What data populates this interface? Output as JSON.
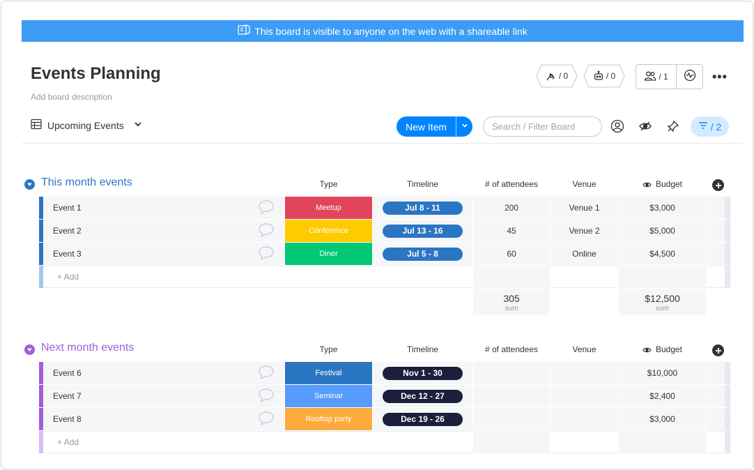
{
  "banner": {
    "text": "This board is visible to anyone on the web with a shareable link"
  },
  "board": {
    "title": "Events Planning",
    "description": "Add board description"
  },
  "header": {
    "integrations_count": "/ 0",
    "automations_count": "/ 0",
    "members_count": "/ 1"
  },
  "toolbar": {
    "view_name": "Upcoming Events",
    "new_item_label": "New Item",
    "search_placeholder": "Search / Filter Board",
    "filter_count": "/ 2"
  },
  "columns": {
    "type": "Type",
    "timeline": "Timeline",
    "attendees": "# of attendees",
    "venue": "Venue",
    "budget": "Budget"
  },
  "groups": [
    {
      "title": "This month events",
      "color": "#2b76c3",
      "strip_color": "#2b76c3",
      "add_strip_color": "#a5c8ea",
      "add_label": "+ Add",
      "rows": [
        {
          "name": "Event 1",
          "type": "Meetup",
          "type_color": "#e2445c",
          "timeline": "Jul 8 - 11",
          "timeline_color": "#2b76c3",
          "attendees": "200",
          "venue": "Venue 1",
          "budget": "$3,000"
        },
        {
          "name": "Event 2",
          "type": "Conference",
          "type_color": "#ffcb00",
          "timeline": "Jul 13 - 16",
          "timeline_color": "#2b76c3",
          "attendees": "45",
          "venue": "Venue 2",
          "budget": "$5,000"
        },
        {
          "name": "Event 3",
          "type": "Diner",
          "type_color": "#00c875",
          "timeline": "Jul 5 - 8",
          "timeline_color": "#2b76c3",
          "attendees": "60",
          "venue": "Online",
          "budget": "$4,500"
        }
      ],
      "summary": {
        "attendees": "305",
        "budget": "$12,500",
        "label": "sum"
      }
    },
    {
      "title": "Next month events",
      "color": "#a25ddc",
      "strip_color": "#a25ddc",
      "add_strip_color": "#d8bff0",
      "add_label": "+ Add",
      "rows": [
        {
          "name": "Event 6",
          "type": "Festival",
          "type_color": "#2b76c3",
          "timeline": "Nov 1 - 30",
          "timeline_color": "#1c1f3b",
          "attendees": "",
          "venue": "",
          "budget": "$10,000"
        },
        {
          "name": "Event 7",
          "type": "Seminar",
          "type_color": "#579bfc",
          "timeline": "Dec 12 - 27",
          "timeline_color": "#1c1f3b",
          "attendees": "",
          "venue": "",
          "budget": "$2,400"
        },
        {
          "name": "Event 8",
          "type": "Rooftop party",
          "type_color": "#fdab3d",
          "timeline": "Dec 19 - 26",
          "timeline_color": "#1c1f3b",
          "attendees": "",
          "venue": "",
          "budget": "$3,000"
        }
      ]
    }
  ]
}
